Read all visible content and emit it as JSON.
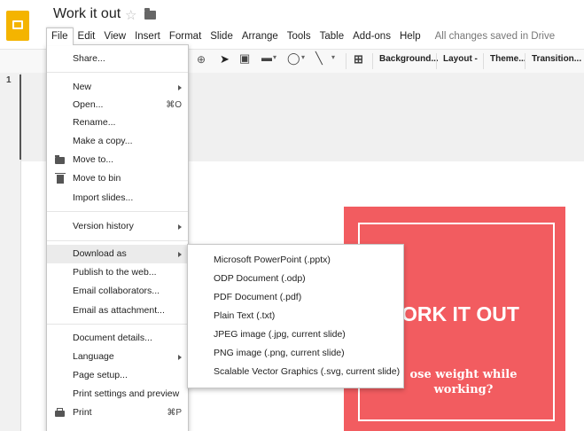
{
  "app": {
    "doc_title": "Work it out",
    "saved_status": "All changes saved in Drive"
  },
  "menubar": [
    "File",
    "Edit",
    "View",
    "Insert",
    "Format",
    "Slide",
    "Arrange",
    "Tools",
    "Table",
    "Add-ons",
    "Help"
  ],
  "toolbar": {
    "background": "Background...",
    "layout": "Layout -",
    "theme": "Theme...",
    "transition": "Transition..."
  },
  "filmstrip": {
    "slide_number": "1"
  },
  "file_menu": {
    "items": [
      {
        "label": "Share...",
        "shortcut": ""
      },
      {
        "label": "New",
        "shortcut": ""
      },
      {
        "label": "Open...",
        "shortcut": "⌘O"
      },
      {
        "label": "Rename...",
        "shortcut": ""
      },
      {
        "label": "Make a copy...",
        "shortcut": ""
      },
      {
        "label": "Move to...",
        "shortcut": ""
      },
      {
        "label": "Move to bin",
        "shortcut": ""
      },
      {
        "label": "Import slides...",
        "shortcut": ""
      },
      {
        "label": "Version history",
        "shortcut": ""
      },
      {
        "label": "Download as",
        "shortcut": ""
      },
      {
        "label": "Publish to the web...",
        "shortcut": ""
      },
      {
        "label": "Email collaborators...",
        "shortcut": ""
      },
      {
        "label": "Email as attachment...",
        "shortcut": ""
      },
      {
        "label": "Document details...",
        "shortcut": ""
      },
      {
        "label": "Language",
        "shortcut": ""
      },
      {
        "label": "Page setup...",
        "shortcut": ""
      },
      {
        "label": "Print settings and preview",
        "shortcut": ""
      },
      {
        "label": "Print",
        "shortcut": "⌘P"
      }
    ]
  },
  "download_submenu": {
    "items": [
      "Microsoft PowerPoint (.pptx)",
      "ODP Document (.odp)",
      "PDF Document (.pdf)",
      "Plain Text (.txt)",
      "JPEG image (.jpg, current slide)",
      "PNG image (.png, current slide)",
      "Scalable Vector Graphics (.svg, current slide)"
    ]
  },
  "slide": {
    "title": "ORK IT OUT",
    "subtitle": "ose weight while working?",
    "background_color": "#f25c60"
  },
  "colors": {
    "logo": "#f4b400",
    "menu_highlight": "#ebebeb"
  }
}
